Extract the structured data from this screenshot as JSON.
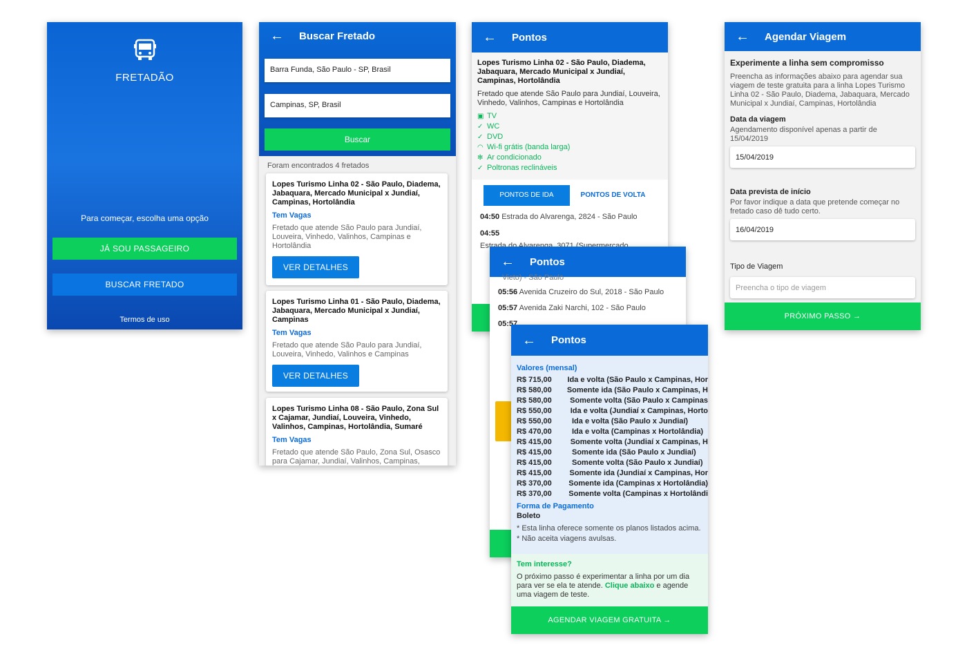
{
  "screen1": {
    "app_name": "FRETADÃO",
    "prompt": "Para começar, escolha uma opção",
    "btn_passenger": "JÁ SOU PASSAGEIRO",
    "btn_search": "BUSCAR FRETADO",
    "terms": "Termos de uso"
  },
  "screen2": {
    "title": "Buscar Fretado",
    "origin_value": "Barra Funda, São Paulo - SP, Brasil",
    "destination_value": "Campinas, SP, Brasil",
    "search_button": "Buscar",
    "results_count": "Foram encontrados 4 fretados",
    "results": [
      {
        "title": "Lopes Turismo Linha 02 - São Paulo, Diadema, Jabaquara, Mercado Municipal x Jundiaí, Campinas, Hortolândia",
        "vagas": "Tem Vagas",
        "desc": "Fretado que atende São Paulo para Jundiaí, Louveira, Vinhedo, Valinhos, Campinas e Hortolândia",
        "button": "VER DETALHES"
      },
      {
        "title": "Lopes Turismo Linha 01 - São Paulo, Diadema, Jabaquara, Mercado Municipal x Jundiaí, Campinas",
        "vagas": "Tem Vagas",
        "desc": "Fretado que atende São Paulo para Jundiaí, Louveira, Vinhedo, Valinhos e Campinas",
        "button": "VER DETALHES"
      },
      {
        "title": "Lopes Turismo Linha 08 - São Paulo, Zona Sul x Cajamar, Jundiaí, Louveira, Vinhedo, Valinhos, Campinas, Hortolândia, Sumaré",
        "vagas": "Tem Vagas",
        "desc": "Fretado que atende São Paulo, Zona Sul, Osasco para Cajamar, Jundiaí, Valinhos, Campinas,"
      }
    ]
  },
  "screen3": {
    "title": "Pontos",
    "line_title": "Lopes Turismo Linha 02 - São Paulo, Diadema, Jabaquara, Mercado Municipal x Jundiaí, Campinas, Hortolândia",
    "line_desc": "Fretado que atende São Paulo para Jundiaí, Louveira, Vinhedo, Valinhos, Campinas e Hortolândia",
    "features": [
      {
        "icon": "tv-icon",
        "label": "TV"
      },
      {
        "icon": "check-icon",
        "label": "WC"
      },
      {
        "icon": "check-icon",
        "label": "DVD"
      },
      {
        "icon": "wifi-icon",
        "label": "Wi-fi grátis (banda larga)"
      },
      {
        "icon": "snowflake-icon",
        "label": "Ar condicionado"
      },
      {
        "icon": "check-icon",
        "label": "Poltronas reclináveis"
      }
    ],
    "tab_ida": "PONTOS DE IDA",
    "tab_volta": "PONTOS DE VOLTA",
    "stops": [
      {
        "time": "04:50",
        "place": "Estrada do Alvarenga, 2824 - São Paulo"
      },
      {
        "time": "04:55",
        "place": "Estrada do Alvarenga, 3071 (Supermercado"
      }
    ]
  },
  "screen4": {
    "title": "Pontos",
    "partial_text": "Vieto) - São Paulo",
    "stops": [
      {
        "time": "05:56",
        "place": "Avenida Cruzeiro do Sul, 2018 - São Paulo"
      },
      {
        "time": "05:57",
        "place": "Avenida Zaki Narchi, 102 - São Paulo"
      }
    ],
    "partial_time": "05:57"
  },
  "screen5": {
    "title": "Pontos",
    "prices_heading": "Valores (mensal)",
    "prices": [
      {
        "value": "R$ 715,00",
        "desc": "Ida e volta (São Paulo x Campinas, Hor"
      },
      {
        "value": "R$ 580,00",
        "desc": "Somente ida (São Paulo x Campinas, H"
      },
      {
        "value": "R$ 580,00",
        "desc": "Somente volta  (São Paulo x Campinas"
      },
      {
        "value": "R$ 550,00",
        "desc": "Ida e volta (Jundiaí x Campinas, Horto"
      },
      {
        "value": "R$ 550,00",
        "desc": "Ida e volta (São Paulo x Jundiaí)"
      },
      {
        "value": "R$ 470,00",
        "desc": "Ida e volta (Campinas x Hortolândia)"
      },
      {
        "value": "R$ 415,00",
        "desc": "Somente volta (Jundiaí x Campinas, H"
      },
      {
        "value": "R$ 415,00",
        "desc": "Somente ida (São Paulo x Jundiaí)"
      },
      {
        "value": "R$ 415,00",
        "desc": "Somente volta  (São Paulo x Jundiaí)"
      },
      {
        "value": "R$ 415,00",
        "desc": "Somente ida (Jundiaí x Campinas, Hor"
      },
      {
        "value": "R$ 370,00",
        "desc": "Somente ida (Campinas x Hortolândia)"
      },
      {
        "value": "R$ 370,00",
        "desc": "Somente volta (Campinas x Hortolândi"
      }
    ],
    "payment_heading": "Forma de Pagamento",
    "payment_value": "Boleto",
    "note1": "* Esta linha oferece somente os planos listados acima.",
    "note2": "* Não aceita viagens avulsas.",
    "interest_heading": "Tem interesse?",
    "interest_text1": "O próximo passo é experimentar a linha por um dia para ver se ela te atende.",
    "interest_link": "Clique abaixo",
    "interest_text2": "e agende uma viagem de teste.",
    "cta": "AGENDAR VIAGEM GRATUITA →"
  },
  "screen6": {
    "title": "Agendar Viagem",
    "heading": "Experimente a linha sem compromisso",
    "intro": "Preencha as informações abaixo para agendar sua viagem de teste gratuita para a linha Lopes Turismo Linha 02 - São Paulo, Diadema, Jabaquara, Mercado Municipal x Jundiaí, Campinas, Hortolândia",
    "date_label": "Data da viagem",
    "date_hint": "Agendamento disponível apenas a partir de 15/04/2019",
    "date_value": "15/04/2019",
    "start_label": "Data prevista de início",
    "start_hint": "Por favor indique a data que pretende começar no fretado caso dê tudo certo.",
    "start_value": "16/04/2019",
    "type_label": "Tipo de Viagem",
    "type_placeholder": "Preencha o tipo de viagem",
    "next": "PRÓXIMO PASSO →"
  }
}
